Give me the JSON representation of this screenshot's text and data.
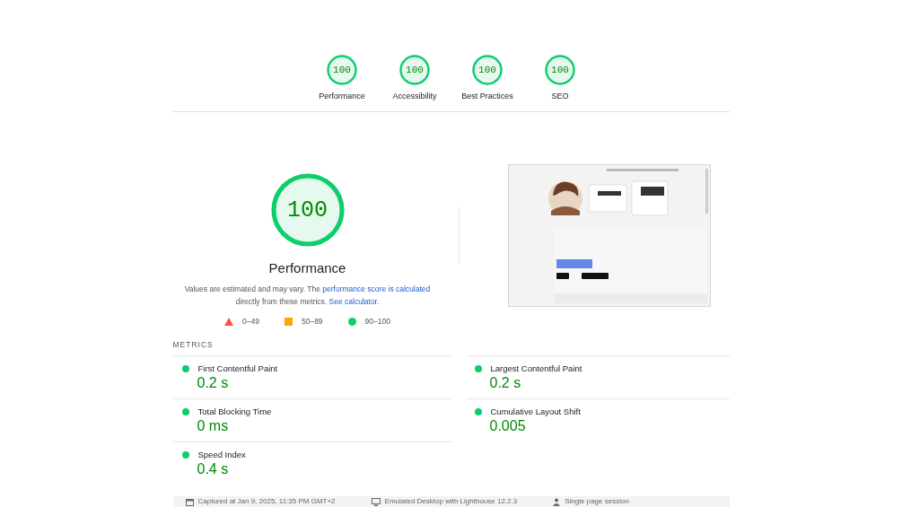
{
  "categories": [
    {
      "score": "100",
      "label": "Performance",
      "level": 1
    },
    {
      "score": "100",
      "label": "Accessibility",
      "level": 1
    },
    {
      "score": "100",
      "label": "Best Practices",
      "level": 1
    },
    {
      "score": "100",
      "label": "SEO",
      "level": 1
    }
  ],
  "performance": {
    "score": "100",
    "level": 1,
    "title": "Performance",
    "note_before": "Values are estimated and may vary. The ",
    "note_link": "performance score is calculated",
    "note_middle": " directly from these metrics. ",
    "note_link2": "See calculator.",
    "legend": [
      {
        "kind": "fail",
        "range": "0–49"
      },
      {
        "kind": "average",
        "range": "50–89"
      },
      {
        "kind": "pass",
        "range": "90–100"
      }
    ]
  },
  "metrics_heading": "METRICS",
  "metrics": [
    {
      "name": "First Contentful Paint",
      "value": "0.2 s",
      "kind": "pass"
    },
    {
      "name": "Largest Contentful Paint",
      "value": "0.2 s",
      "kind": "pass"
    },
    {
      "name": "Total Blocking Time",
      "value": "0 ms",
      "kind": "pass"
    },
    {
      "name": "Cumulative Layout Shift",
      "value": "0.005",
      "kind": "pass"
    },
    {
      "name": "Speed Index",
      "value": "0.4 s",
      "kind": "pass"
    }
  ],
  "footer": [
    {
      "kind": "calendar",
      "text": "Captured at Jan 9, 2025, 11:35 PM GMT+2"
    },
    {
      "kind": "desktop",
      "text": "Emulated Desktop with Lighthouse 12.2.3"
    },
    {
      "kind": "person",
      "text": "Single page session"
    }
  ]
}
